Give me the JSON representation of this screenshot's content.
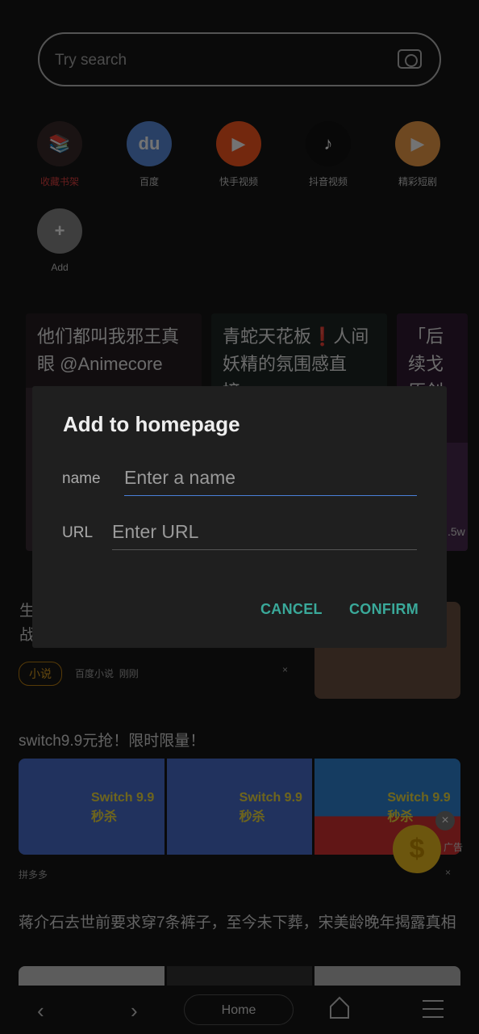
{
  "search": {
    "placeholder": "Try search",
    "icon": "camera-icon"
  },
  "shortcuts": [
    {
      "label": "收藏书架",
      "color": "#3a2a2a",
      "glyph": "📚",
      "label_color": "#e04040"
    },
    {
      "label": "百度",
      "color": "#5b8fe0",
      "glyph": "du"
    },
    {
      "label": "快手视频",
      "color": "#ff5a1f",
      "glyph": "▶"
    },
    {
      "label": "抖音视频",
      "color": "#111111",
      "glyph": "♪"
    },
    {
      "label": "精彩短剧",
      "color": "#f5a04a",
      "glyph": "▶"
    },
    {
      "label": "Add",
      "color": "#8a8a8a",
      "glyph": "+"
    }
  ],
  "videos": [
    {
      "title": "他们都叫我邪王真眼 @Animecore"
    },
    {
      "title": "青蛇天花板❗人间妖精的氛围感直接..."
    },
    {
      "title": "「后续戈原创阁"
    }
  ],
  "video_meta": ".5w",
  "dialog": {
    "title": "Add to homepage",
    "name_label": "name",
    "name_placeholder": "Enter a name",
    "url_label": "URL",
    "url_placeholder": "Enter URL",
    "cancel": "CANCEL",
    "confirm": "CONFIRM",
    "accent": "#3aa99a",
    "focus_color": "#4a7fd8"
  },
  "feed": [
    {
      "title": "生 战",
      "tag": "小说",
      "source": "百度小说",
      "time": "刚刚"
    },
    {
      "title": "switch9.9元抢！限时限量！",
      "source": "拼多多",
      "ad_text": "Switch 9.9秒杀",
      "ad_badge": "广告"
    },
    {
      "title": "蒋介石去世前要求穿7条裤子，至今未下葬，宋美龄晚年揭露真相"
    }
  ],
  "bottom_nav": {
    "home": "Home"
  }
}
